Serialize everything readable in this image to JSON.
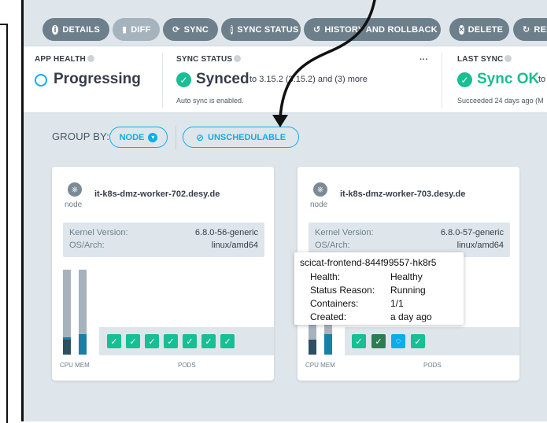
{
  "toolbar": {
    "details": "DETAILS",
    "diff": "DIFF",
    "sync": "SYNC",
    "sync_status": "SYNC STATUS",
    "history": "HISTORY AND ROLLBACK",
    "delete": "DELETE",
    "refresh": "REF"
  },
  "status": {
    "app_health_label": "APP HEALTH",
    "app_health_value": "Progressing",
    "sync_status_label": "SYNC STATUS",
    "sync_status_value": "Synced",
    "sync_status_detail": "to 3.15.2 (3.15.2) and (3) more",
    "sync_status_sub": "Auto sync is enabled.",
    "more": "···",
    "last_sync_label": "LAST SYNC",
    "last_sync_value": "Sync OK",
    "last_sync_to": "to",
    "last_sync_sub": "Succeeded 24 days ago (M"
  },
  "groupby": {
    "label": "GROUP BY:",
    "node_pill": "NODE",
    "unschedulable_pill": "UNSCHEDULABLE"
  },
  "nodes": [
    {
      "name": "it-k8s-dmz-worker-702.desy.de",
      "type": "node",
      "kernel_label": "Kernel Version:",
      "kernel_value": "6.8.0-56-generic",
      "os_label": "OS/Arch:",
      "os_value": "linux/amd64",
      "cpu_label": "CPU MEM",
      "pods_label": "PODS"
    },
    {
      "name": "it-k8s-dmz-worker-703.desy.de",
      "type": "node",
      "kernel_label": "Kernel Version:",
      "kernel_value": "6.8.0-57-generic",
      "os_label": "OS/Arch:",
      "os_value": "linux/amd64",
      "cpu_label": "CPU MEM",
      "pods_label": "PODS"
    }
  ],
  "tooltip": {
    "title": "scicat-frontend-844f99557-hk8r5",
    "health_label": "Health:",
    "health_value": "Healthy",
    "reason_label": "Status Reason:",
    "reason_value": "Running",
    "containers_label": "Containers:",
    "containers_value": "1/1",
    "created_label": "Created:",
    "created_value": "a day ago"
  },
  "colors": {
    "accent": "#0dadea",
    "healthy": "#18be94",
    "toolbar_button": "#6d7f8b",
    "background": "#dee6eb"
  }
}
